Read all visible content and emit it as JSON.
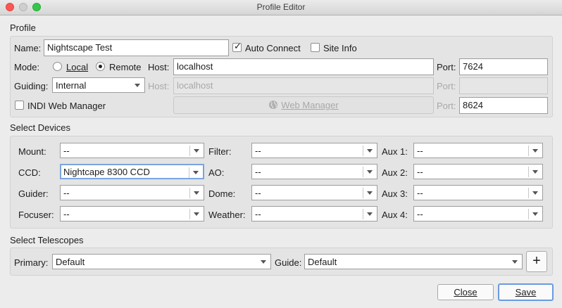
{
  "window": {
    "title": "Profile Editor"
  },
  "profile": {
    "section_label": "Profile",
    "name_label": "Name:",
    "name_value": "Nightscape Test",
    "auto_connect_label": "Auto Connect",
    "site_info_label": "Site Info",
    "mode_label": "Mode:",
    "local_label": "Local",
    "remote_label": "Remote",
    "host_label": "Host:",
    "host_value": "localhost",
    "port_label": "Port:",
    "port_value": "7624",
    "guiding_label": "Guiding:",
    "guiding_value": "Internal",
    "guide_host_label": "Host:",
    "guide_host_value": "localhost",
    "guide_port_label": "Port:",
    "guide_port_value": "",
    "indi_web_manager_label": "INDI Web Manager",
    "web_manager_button_label": "Web Manager",
    "web_port_label": "Port:",
    "web_port_value": "8624"
  },
  "devices": {
    "section_label": "Select Devices",
    "mount_label": "Mount:",
    "mount_value": "--",
    "ccd_label": "CCD:",
    "ccd_value": "Nightcape 8300 CCD",
    "guider_label": "Guider:",
    "guider_value": "--",
    "focuser_label": "Focuser:",
    "focuser_value": "--",
    "filter_label": "Filter:",
    "filter_value": "--",
    "ao_label": "AO:",
    "ao_value": "--",
    "dome_label": "Dome:",
    "dome_value": "--",
    "weather_label": "Weather:",
    "weather_value": "--",
    "aux1_label": "Aux 1:",
    "aux1_value": "--",
    "aux2_label": "Aux 2:",
    "aux2_value": "--",
    "aux3_label": "Aux 3:",
    "aux3_value": "--",
    "aux4_label": "Aux 4:",
    "aux4_value": "--"
  },
  "telescopes": {
    "section_label": "Select Telescopes",
    "primary_label": "Primary:",
    "primary_value": "Default",
    "guide_label": "Guide:",
    "guide_value": "Default",
    "add_label": "+"
  },
  "footer": {
    "close_label": "Close",
    "save_label": "Save"
  }
}
